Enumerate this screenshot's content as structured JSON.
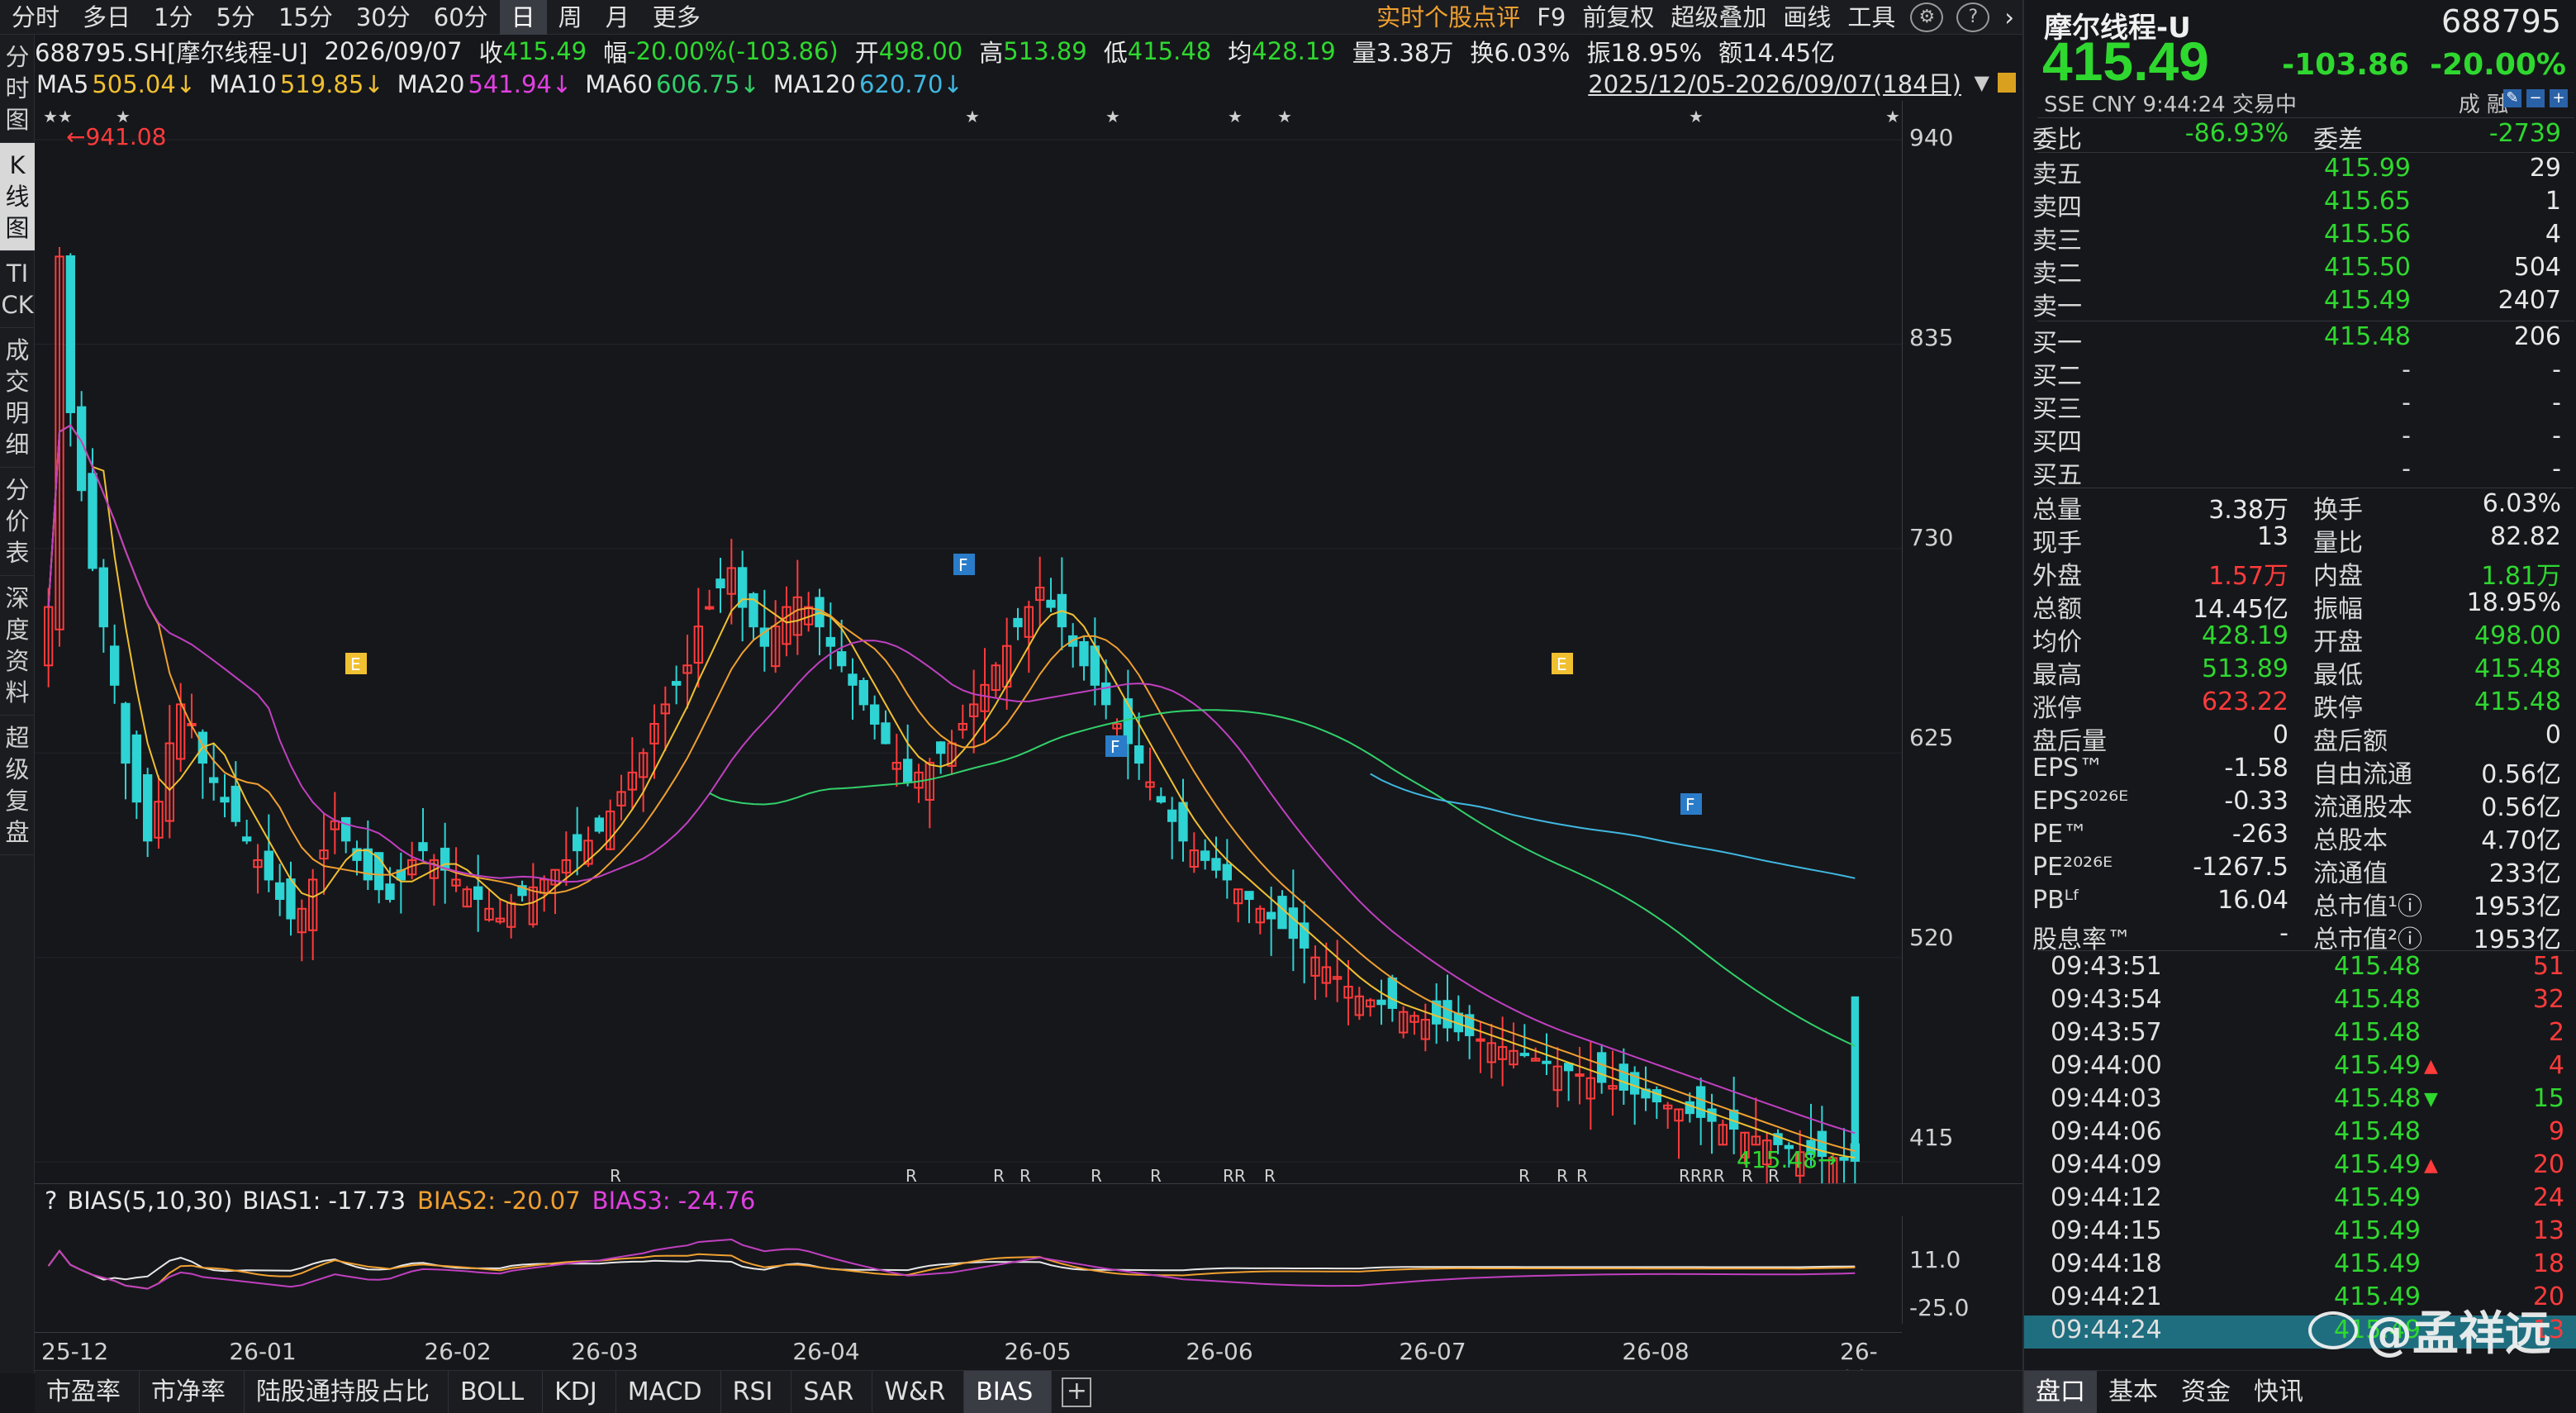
{
  "topbar": {
    "tabs": [
      "分时",
      "多日",
      "1分",
      "5分",
      "15分",
      "30分",
      "60分",
      "日",
      "周",
      "月",
      "更多"
    ],
    "active_index": 7,
    "right_items": [
      "实时个股点评",
      "F9",
      "前复权",
      "超级叠加",
      "画线",
      "工具"
    ]
  },
  "leftnav": {
    "items": [
      "分时图",
      "K线图",
      "TICK",
      "成交明细",
      "分价表",
      "深度资料",
      "超级复盘"
    ],
    "active_index": 1
  },
  "info": {
    "code": "688795.SH[摩尔线程-U]",
    "date": "2026/09/07",
    "close_label": "收",
    "close": "415.49",
    "pct_label": "幅",
    "pct": "-20.00%(-103.86)",
    "open_label": "开",
    "open": "498.00",
    "high_label": "高",
    "high": "513.89",
    "low_label": "低",
    "low": "415.48",
    "avg_label": "均",
    "avg": "428.19",
    "vol": "量3.38万",
    "turnover": "换6.03%",
    "amplitude": "振18.95%",
    "amount": "额14.45亿"
  },
  "ma": {
    "ma5": "MA5",
    "ma5_val": "505.04↓",
    "ma10": "MA10",
    "ma10_val": "519.85↓",
    "ma20": "MA20",
    "ma20_val": "541.94↓",
    "ma60": "MA60",
    "ma60_val": "606.75↓",
    "ma120": "MA120",
    "ma120_val": "620.70↓",
    "daterange": "2025/12/05-2026/09/07(184日)"
  },
  "chart_data": {
    "type": "candlestick",
    "y_ticks": [
      "940",
      "835",
      "730",
      "625",
      "520",
      "415"
    ],
    "ylim": [
      404,
      960
    ],
    "x_ticks": [
      "25-12",
      "26-01",
      "26-02",
      "26-03",
      "26-04",
      "26-05",
      "26-06",
      "26-07",
      "26-08",
      "26-09"
    ],
    "max_label": "941.08",
    "last_label": "415.48",
    "markers": [
      {
        "label": "E",
        "color": "#f0c030"
      },
      {
        "label": "F",
        "color": "#2a7cc8"
      },
      {
        "label": "F",
        "color": "#2a7cc8"
      },
      {
        "label": "E",
        "color": "#f0c030"
      },
      {
        "label": "F",
        "color": "#2a7cc8"
      }
    ],
    "r_labels": [
      "R",
      "R",
      "R",
      "R",
      "R",
      "R",
      "RR",
      "R",
      "R",
      "R",
      "R",
      "RRRR",
      "R",
      "R"
    ],
    "star_labels": [
      "★★",
      "★",
      "★",
      "★",
      "★",
      "★",
      "★",
      "★"
    ],
    "closes": [
      700,
      880,
      800,
      760,
      720,
      690,
      660,
      620,
      600,
      580,
      600,
      630,
      650,
      640,
      620,
      610,
      600,
      590,
      580,
      570,
      560,
      550,
      540,
      545,
      560,
      575,
      590,
      580,
      570,
      560,
      555,
      550,
      560,
      570,
      575,
      570,
      565,
      560,
      555,
      550,
      545,
      540,
      548,
      552,
      556,
      560,
      565,
      570,
      575,
      580,
      585,
      595,
      605,
      615,
      625,
      640,
      650,
      660,
      670,
      690,
      700,
      710,
      720,
      700,
      690,
      680,
      690,
      700,
      705,
      700,
      690,
      680,
      670,
      660,
      650,
      640,
      630,
      620,
      610,
      615,
      620,
      625,
      630,
      640,
      650,
      660,
      670,
      680,
      690,
      700,
      710,
      700,
      690,
      680,
      670,
      660,
      650,
      640,
      630,
      620,
      610,
      600,
      590,
      580,
      575,
      570,
      565,
      560,
      555,
      550,
      545,
      540,
      535,
      530,
      525,
      520,
      515,
      510,
      505,
      500,
      498,
      496,
      494,
      492,
      490,
      488,
      486,
      484,
      482,
      480,
      478,
      476,
      474,
      472,
      470,
      468,
      466,
      464,
      462,
      460,
      458,
      456,
      454,
      452,
      450,
      448,
      446,
      444,
      442,
      440,
      438,
      436,
      434,
      432,
      430,
      428,
      426,
      424,
      422,
      420,
      419,
      418,
      417,
      416,
      415.49
    ],
    "bias_header": {
      "label": "BIAS(5,10,30)",
      "bias1": "BIAS1: -17.73",
      "bias2": "BIAS2: -20.07",
      "bias3": "BIAS3: -24.76"
    },
    "bias_ticks": [
      "11.0",
      "-25.0"
    ]
  },
  "bottomtabs": {
    "items": [
      "市盈率",
      "市净率",
      "陆股通持股占比",
      "BOLL",
      "KDJ",
      "MACD",
      "RSI",
      "SAR",
      "W&R",
      "BIAS"
    ],
    "active_index": 9
  },
  "rightpanel": {
    "name": "摩尔线程-U",
    "code": "688795",
    "price": "415.49",
    "change": "-103.86",
    "change_pct": "-20.00%",
    "sub": "SSE  CNY  9:44:24  交易中",
    "rz": "成 融",
    "weibi_label": "委比",
    "weibi": "-86.93%",
    "weicha_label": "委差",
    "weicha": "-2739",
    "asks": [
      {
        "label": "卖五",
        "price": "415.99",
        "vol": "29"
      },
      {
        "label": "卖四",
        "price": "415.65",
        "vol": "1"
      },
      {
        "label": "卖三",
        "price": "415.56",
        "vol": "4"
      },
      {
        "label": "卖二",
        "price": "415.50",
        "vol": "504"
      },
      {
        "label": "卖一",
        "price": "415.49",
        "vol": "2407"
      }
    ],
    "bids": [
      {
        "label": "买一",
        "price": "415.48",
        "vol": "206"
      },
      {
        "label": "买二",
        "price": "-",
        "vol": "-"
      },
      {
        "label": "买三",
        "price": "-",
        "vol": "-"
      },
      {
        "label": "买四",
        "price": "-",
        "vol": "-"
      },
      {
        "label": "买五",
        "price": "-",
        "vol": "-"
      }
    ],
    "stats": [
      {
        "k1": "总量",
        "v1": "3.38万",
        "c1": "white",
        "k2": "换手",
        "v2": "6.03%",
        "c2": "white"
      },
      {
        "k1": "现手",
        "v1": "13",
        "c1": "white",
        "k2": "量比",
        "v2": "82.82",
        "c2": "white"
      },
      {
        "k1": "外盘",
        "v1": "1.57万",
        "c1": "red",
        "k2": "内盘",
        "v2": "1.81万",
        "c2": "green"
      },
      {
        "k1": "总额",
        "v1": "14.45亿",
        "c1": "white",
        "k2": "振幅",
        "v2": "18.95%",
        "c2": "white"
      },
      {
        "k1": "均价",
        "v1": "428.19",
        "c1": "green",
        "k2": "开盘",
        "v2": "498.00",
        "c2": "green"
      },
      {
        "k1": "最高",
        "v1": "513.89",
        "c1": "green",
        "k2": "最低",
        "v2": "415.48",
        "c2": "green"
      },
      {
        "k1": "涨停",
        "v1": "623.22",
        "c1": "red",
        "k2": "跌停",
        "v2": "415.48",
        "c2": "green"
      },
      {
        "k1": "盘后量",
        "v1": "0",
        "c1": "white",
        "k2": "盘后额",
        "v2": "0",
        "c2": "white"
      },
      {
        "k1": "EPS™",
        "v1": "-1.58",
        "c1": "white",
        "k2": "自由流通",
        "v2": "0.56亿",
        "c2": "white"
      },
      {
        "k1": "EPS²⁰²⁶ᴱ",
        "v1": "-0.33",
        "c1": "white",
        "k2": "流通股本",
        "v2": "0.56亿",
        "c2": "white"
      },
      {
        "k1": "PE™",
        "v1": "-263",
        "c1": "white",
        "k2": "总股本",
        "v2": "4.70亿",
        "c2": "white"
      },
      {
        "k1": "PE²⁰²⁶ᴱ",
        "v1": "-1267.5",
        "c1": "white",
        "k2": "流通值",
        "v2": "233亿",
        "c2": "white"
      },
      {
        "k1": "PBᴸᶠ",
        "v1": "16.04",
        "c1": "white",
        "k2": "总市值¹ⓘ",
        "v2": "1953亿",
        "c2": "white"
      },
      {
        "k1": "股息率™",
        "v1": "-",
        "c1": "white",
        "k2": "总市值²ⓘ",
        "v2": "1953亿",
        "c2": "white"
      }
    ],
    "ticks": [
      {
        "t": "09:43:51",
        "p": "415.48",
        "arrow": "",
        "v": "51",
        "vc": "red"
      },
      {
        "t": "09:43:54",
        "p": "415.48",
        "arrow": "",
        "v": "32",
        "vc": "red"
      },
      {
        "t": "09:43:57",
        "p": "415.48",
        "arrow": "",
        "v": "2",
        "vc": "red"
      },
      {
        "t": "09:44:00",
        "p": "415.49",
        "arrow": "▲",
        "v": "4",
        "vc": "red"
      },
      {
        "t": "09:44:03",
        "p": "415.48",
        "arrow": "▼",
        "v": "15",
        "vc": "green"
      },
      {
        "t": "09:44:06",
        "p": "415.48",
        "arrow": "",
        "v": "9",
        "vc": "red"
      },
      {
        "t": "09:44:09",
        "p": "415.49",
        "arrow": "▲",
        "v": "20",
        "vc": "red"
      },
      {
        "t": "09:44:12",
        "p": "415.49",
        "arrow": "",
        "v": "24",
        "vc": "red"
      },
      {
        "t": "09:44:15",
        "p": "415.49",
        "arrow": "",
        "v": "13",
        "vc": "red"
      },
      {
        "t": "09:44:18",
        "p": "415.49",
        "arrow": "",
        "v": "18",
        "vc": "red"
      },
      {
        "t": "09:44:21",
        "p": "415.49",
        "arrow": "",
        "v": "20",
        "vc": "red"
      },
      {
        "t": "09:44:24",
        "p": "415.49",
        "arrow": "",
        "v": "13",
        "vc": "red"
      }
    ],
    "tabs": [
      "盘口",
      "基本",
      "资金",
      "快讯"
    ],
    "active_tab": 0,
    "watermark": "@孟祥远"
  }
}
